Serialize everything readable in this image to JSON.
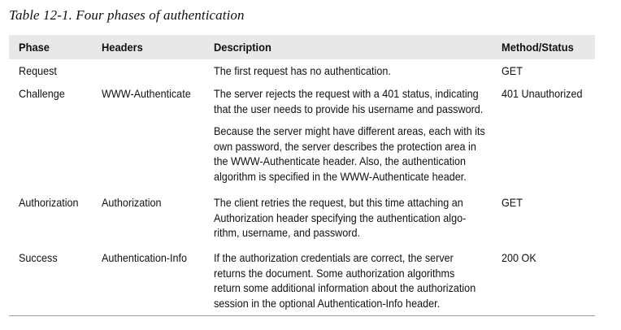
{
  "caption": "Table 12-1. Four phases of authentication",
  "columns": [
    "Phase",
    "Headers",
    "Description",
    "Method/Status"
  ],
  "rows": [
    {
      "phase": "Request",
      "headers": "",
      "description": [
        "The first request has no authentication."
      ],
      "method": "GET"
    },
    {
      "phase": "Challenge",
      "headers": "WWW-Authenticate",
      "description": [
        "The server rejects the request with a 401 status, indicating\nthat the user needs to provide his username and password.",
        "Because the server might have different areas, each with its\nown password, the server describes the protection area in\nthe WWW-Authenticate header. Also, the authentication\nalgorithm is specified in the WWW-Authenticate header."
      ],
      "method": "401 Unauthorized"
    },
    {
      "phase": "Authorization",
      "headers": "Authorization",
      "description": [
        "The client retries the request, but this time attaching an\nAuthorization header specifying the authentication algo-\nrithm, username, and password."
      ],
      "method": "GET"
    },
    {
      "phase": "Success",
      "headers": "Authentication-Info",
      "description": [
        "If the authorization credentials are correct, the server\nreturns the document. Some authorization algorithms\nreturn some additional information about the authorization\nsession in the optional Authentication-Info header."
      ],
      "method": "200 OK"
    }
  ]
}
